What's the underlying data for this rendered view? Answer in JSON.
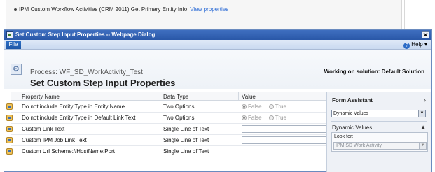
{
  "background": {
    "line1": "IPM Custom Workflow Activities (CRM 2011):Get Primary Entity Info",
    "line1_link": "View properties"
  },
  "dialog": {
    "title": "Set Custom Step Input Properties -- Webpage Dialog",
    "close_glyph": "✕"
  },
  "ribbon": {
    "file_label": "File",
    "help_label": "Help ▾"
  },
  "header": {
    "process_label": "Process: WF_SD_WorkActivity_Test",
    "title": "Set Custom Step Input Properties",
    "solution_label": "Working on solution: Default Solution"
  },
  "grid": {
    "columns": [
      "Property Name",
      "Data Type",
      "Value"
    ],
    "rows": [
      {
        "name": "Do not include Entity Type in Entity Name",
        "type": "Two Options",
        "value_kind": "radio",
        "options": [
          "False",
          "True"
        ],
        "selected": "False"
      },
      {
        "name": "Do not include Entity Type in Default Link Text",
        "type": "Two Options",
        "value_kind": "radio",
        "options": [
          "False",
          "True"
        ],
        "selected": "False"
      },
      {
        "name": "Custom Link Text",
        "type": "Single Line of Text",
        "value_kind": "text",
        "value": ""
      },
      {
        "name": "Custom IPM Job Link Text",
        "type": "Single Line of Text",
        "value_kind": "text",
        "value": ""
      },
      {
        "name": "Custom Url Scheme://HostName:Port",
        "type": "Single Line of Text",
        "value_kind": "text",
        "value": ""
      }
    ]
  },
  "assistant": {
    "title": "Form Assistant",
    "collapse_glyph": "›",
    "dropdown_value": "Dynamic Values",
    "section_label": "Dynamic Values",
    "section_toggle": "▲",
    "look_for_label": "Look for:",
    "look_for_value": "IPM SD Work Activity",
    "dropdown_arrow": "▼"
  },
  "colors": {
    "titlebar": "#2a58a8",
    "file_tab": "#1e57a6",
    "link": "#2a6ad5"
  }
}
